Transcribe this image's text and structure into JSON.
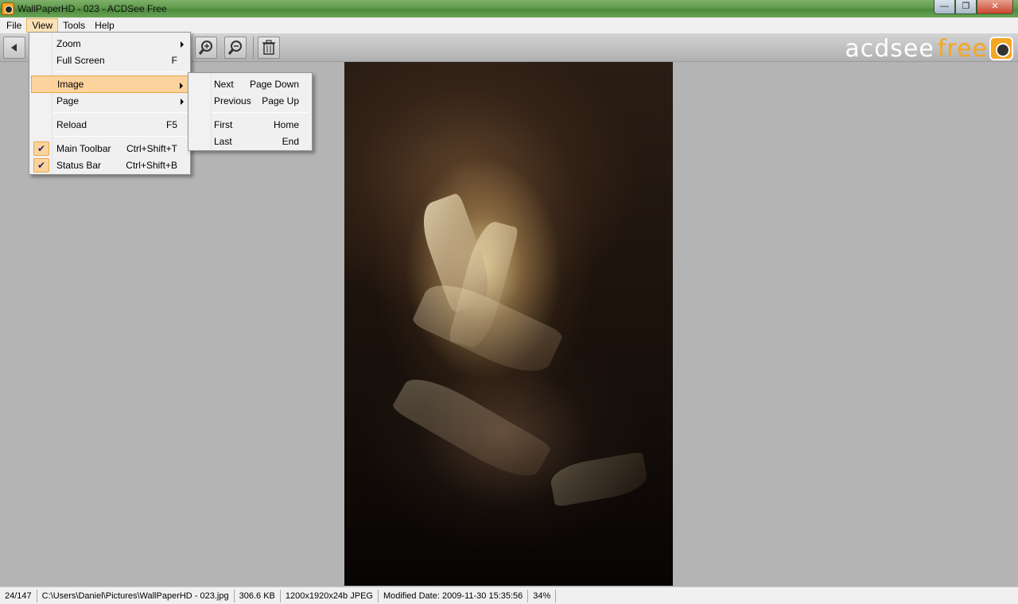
{
  "window": {
    "title": "WallPaperHD - 023 - ACDSee Free",
    "controls": [
      "minimize",
      "restore",
      "close"
    ]
  },
  "menubar": {
    "items": [
      {
        "label": "File",
        "active": false
      },
      {
        "label": "View",
        "active": true
      },
      {
        "label": "Tools",
        "active": false
      },
      {
        "label": "Help",
        "active": false
      }
    ]
  },
  "toolbar": {
    "buttons": [
      {
        "name": "previous-button",
        "icon": "triangle-left-icon"
      },
      {
        "name": "zoom-in-button",
        "icon": "zoom-in-icon"
      },
      {
        "name": "zoom-out-button",
        "icon": "zoom-out-icon"
      },
      {
        "name": "delete-button",
        "icon": "trash-icon"
      }
    ],
    "logo_text": "acdsee",
    "logo_accent": "free"
  },
  "view_menu": {
    "items": [
      {
        "label": "Zoom",
        "shortcut": "",
        "submenu": true,
        "checked": false
      },
      {
        "label": "Full Screen",
        "shortcut": "F",
        "submenu": false,
        "checked": false
      },
      {
        "label": "Image",
        "shortcut": "",
        "submenu": true,
        "checked": false,
        "highlighted": true
      },
      {
        "label": "Page",
        "shortcut": "",
        "submenu": true,
        "checked": false
      },
      {
        "label": "Reload",
        "shortcut": "F5",
        "submenu": false,
        "checked": false
      },
      {
        "label": "Main Toolbar",
        "shortcut": "Ctrl+Shift+T",
        "submenu": false,
        "checked": true
      },
      {
        "label": "Status Bar",
        "shortcut": "Ctrl+Shift+B",
        "submenu": false,
        "checked": true
      }
    ]
  },
  "image_submenu": {
    "items": [
      {
        "label": "Next",
        "shortcut": "Page Down"
      },
      {
        "label": "Previous",
        "shortcut": "Page Up"
      },
      {
        "label": "First",
        "shortcut": "Home"
      },
      {
        "label": "Last",
        "shortcut": "End"
      }
    ]
  },
  "statusbar": {
    "index": "24/147",
    "path": "C:\\Users\\Daniel\\Pictures\\WallPaperHD - 023.jpg",
    "size": "306.6 KB",
    "format": "1200x1920x24b JPEG",
    "modified": "Modified Date: 2009-11-30 15:35:56",
    "zoom": "34%"
  },
  "colors": {
    "titlebar": "#5f9a4c",
    "menu_highlight": "#fcd39d",
    "logo_accent": "#f5a623",
    "viewer_background": "#b4b4b4"
  }
}
